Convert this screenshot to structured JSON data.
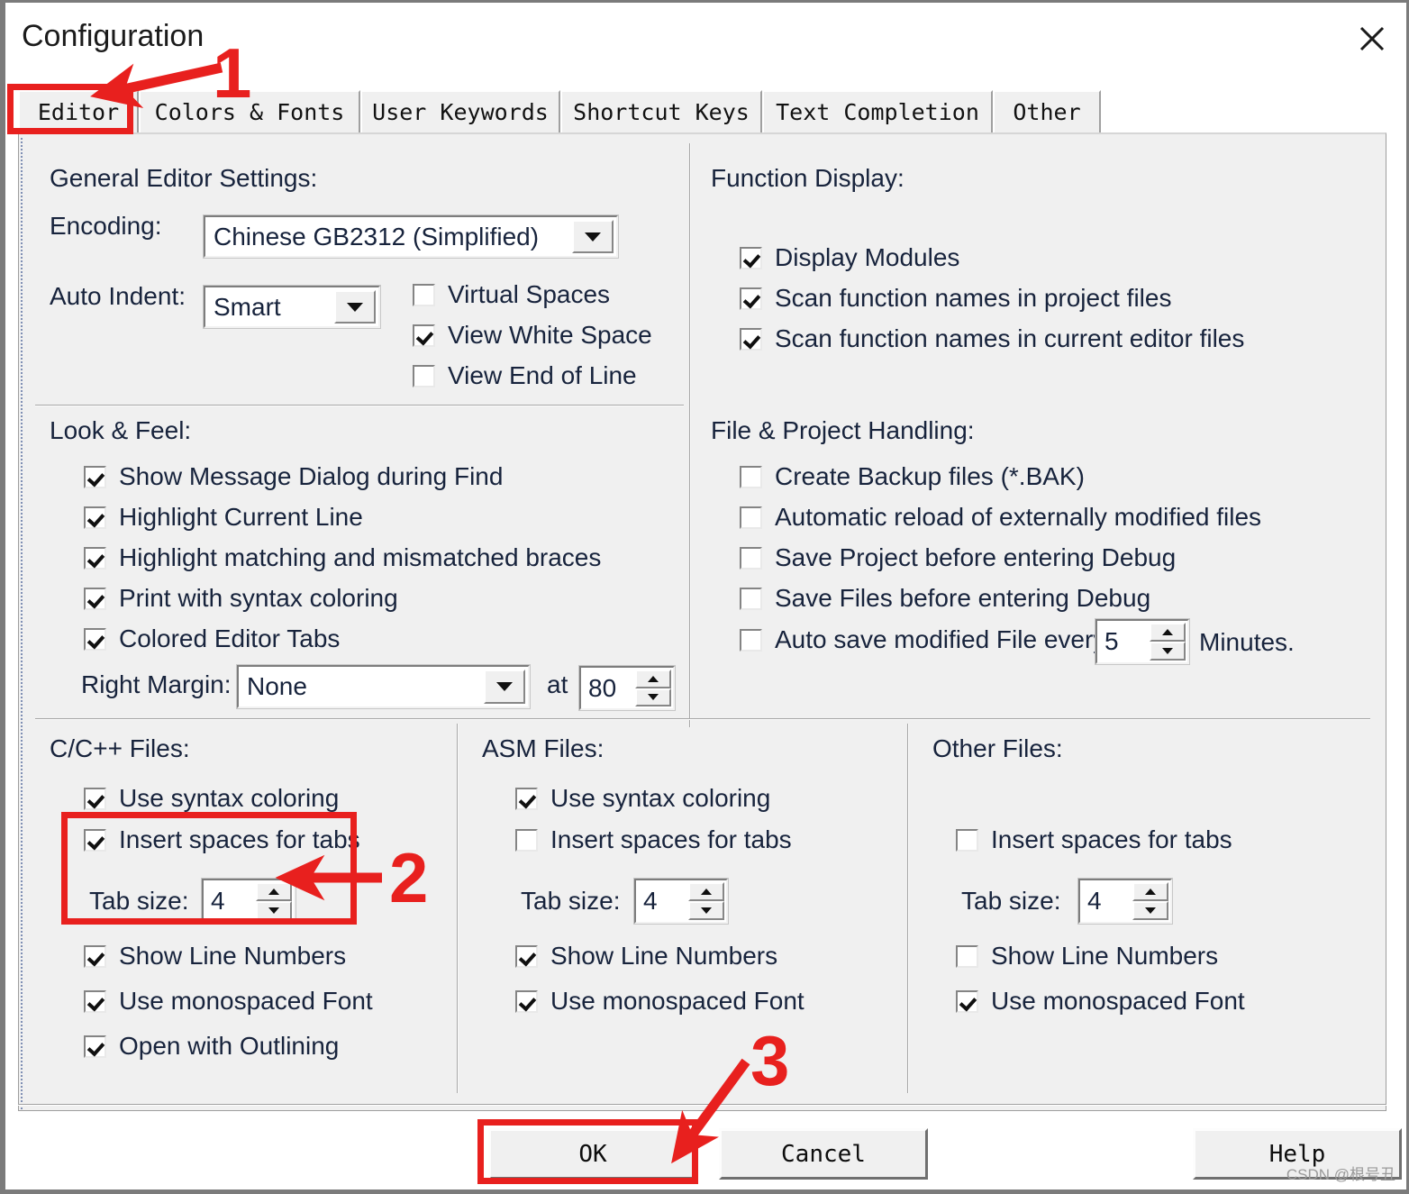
{
  "window": {
    "title": "Configuration",
    "close_icon": "close-icon"
  },
  "tabs": [
    {
      "label": "Editor",
      "selected": true
    },
    {
      "label": "Colors & Fonts",
      "selected": false
    },
    {
      "label": "User Keywords",
      "selected": false
    },
    {
      "label": "Shortcut Keys",
      "selected": false
    },
    {
      "label": "Text Completion",
      "selected": false
    },
    {
      "label": "Other",
      "selected": false
    }
  ],
  "general_editor": {
    "title": "General Editor Settings:",
    "encoding_label": "Encoding:",
    "encoding_value": "Chinese GB2312 (Simplified)",
    "auto_indent_label": "Auto Indent:",
    "auto_indent_value": "Smart",
    "checkboxes": [
      {
        "label": "Virtual Spaces",
        "checked": false
      },
      {
        "label": "View White Space",
        "checked": true
      },
      {
        "label": "View End of Line",
        "checked": false
      }
    ]
  },
  "function_display": {
    "title": "Function Display:",
    "checkboxes": [
      {
        "label": "Display Modules",
        "checked": true
      },
      {
        "label": "Scan function names in project files",
        "checked": true
      },
      {
        "label": "Scan function names in current editor files",
        "checked": true
      }
    ]
  },
  "look_feel": {
    "title": "Look & Feel:",
    "checkboxes": [
      {
        "label": "Show Message Dialog during Find",
        "checked": true
      },
      {
        "label": "Highlight Current Line",
        "checked": true
      },
      {
        "label": "Highlight matching and mismatched braces",
        "checked": true
      },
      {
        "label": "Print with syntax coloring",
        "checked": true
      },
      {
        "label": "Colored Editor Tabs",
        "checked": true
      }
    ],
    "right_margin_label": "Right Margin:",
    "right_margin_value": "None",
    "at_label": "at",
    "at_value": "80"
  },
  "file_project": {
    "title": "File & Project Handling:",
    "checkboxes": [
      {
        "label": "Create Backup files (*.BAK)",
        "checked": false
      },
      {
        "label": "Automatic reload of externally modified files",
        "checked": false
      },
      {
        "label": "Save Project before entering Debug",
        "checked": false
      },
      {
        "label": "Save Files before entering Debug",
        "checked": false
      },
      {
        "label": "Auto save modified File every",
        "checked": false
      }
    ],
    "autosave_value": "5",
    "minutes_label": "Minutes."
  },
  "c_files": {
    "title": "C/C++ Files:",
    "use_syntax_coloring": {
      "label": "Use syntax coloring",
      "checked": true
    },
    "insert_spaces": {
      "label": "Insert spaces for tabs",
      "checked": true
    },
    "tab_size_label": "Tab size:",
    "tab_size_value": "4",
    "show_line_numbers": {
      "label": "Show Line Numbers",
      "checked": true
    },
    "use_monospaced": {
      "label": "Use monospaced Font",
      "checked": true
    },
    "open_outlining": {
      "label": "Open with Outlining",
      "checked": true
    }
  },
  "asm_files": {
    "title": "ASM Files:",
    "use_syntax_coloring": {
      "label": "Use syntax coloring",
      "checked": true
    },
    "insert_spaces": {
      "label": "Insert spaces for tabs",
      "checked": false
    },
    "tab_size_label": "Tab size:",
    "tab_size_value": "4",
    "show_line_numbers": {
      "label": "Show Line Numbers",
      "checked": true
    },
    "use_monospaced": {
      "label": "Use monospaced Font",
      "checked": true
    }
  },
  "other_files": {
    "title": "Other Files:",
    "insert_spaces": {
      "label": "Insert spaces for tabs",
      "checked": false
    },
    "tab_size_label": "Tab size:",
    "tab_size_value": "4",
    "show_line_numbers": {
      "label": "Show Line Numbers",
      "checked": false
    },
    "use_monospaced": {
      "label": "Use monospaced Font",
      "checked": true
    }
  },
  "buttons": {
    "ok": "OK",
    "cancel": "Cancel",
    "help": "Help"
  },
  "annotations": {
    "step1": "1",
    "step2": "2",
    "step3": "3",
    "accent_color": "#e8201e"
  },
  "watermark": "CSDN @根号丑"
}
